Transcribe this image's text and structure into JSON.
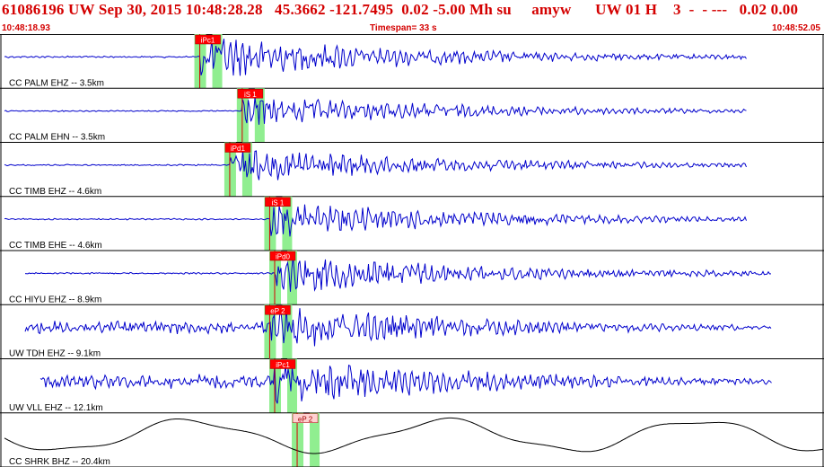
{
  "header": {
    "title": "61086196 UW Sep 30, 2015 10:48:28.28   45.3662 -121.7495  0.02 -5.00 Mh su     amyw      UW 01 H    3  -  - ---   0.02 0.00",
    "start_time": "10:48:18.93",
    "timespan": "Timespan=  33 s",
    "end_time": "10:48:52.05"
  },
  "colors": {
    "title": "#d40000",
    "waveform": "#0000cc",
    "lowfreq_waveform": "#000000",
    "pick_window": "#90ee90",
    "pick_label_bg": "#ff0000",
    "pick_label_alt_bg": "#ffd0d0"
  },
  "traces": [
    {
      "label": "CC PALM EHZ -- 3.5km",
      "pick": "iPc1",
      "onset_s": 8.0,
      "amp": 0.55
    },
    {
      "label": "CC PALM EHN -- 3.5km",
      "pick": "iS 1",
      "onset_s": 9.7,
      "amp": 0.4
    },
    {
      "label": "CC TIMB EHZ -- 4.6km",
      "pick": "iPd1",
      "onset_s": 9.2,
      "amp": 0.45
    },
    {
      "label": "CC TIMB EHE -- 4.6km",
      "pick": "iS 1",
      "onset_s": 10.8,
      "amp": 0.45
    },
    {
      "label": "CC HIYU EHZ -- 8.9km",
      "pick": "iPd0",
      "onset_s": 11.0,
      "amp": 0.5
    },
    {
      "label": "UW TDH EHZ -- 9.1km",
      "pick": "eP 2",
      "onset_s": 10.8,
      "amp": 0.55
    },
    {
      "label": "UW VLL EHZ -- 12.1km",
      "pick": "iPc1",
      "onset_s": 11.0,
      "amp": 0.6
    },
    {
      "label": "CC SHRK BHZ -- 20.4km",
      "pick": "eP 2",
      "onset_s": 11.9,
      "amp": 0.7
    }
  ]
}
